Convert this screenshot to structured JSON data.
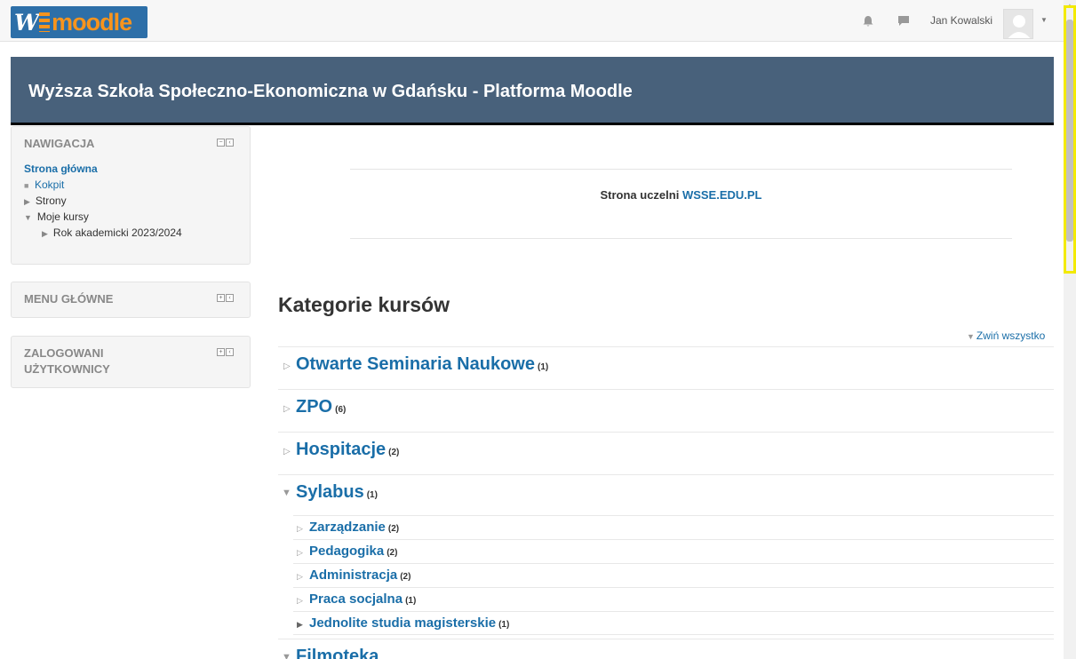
{
  "navbar": {
    "logo_text_w": "W",
    "logo_text_moodle": "moodle",
    "user_name": "Jan Kowalski"
  },
  "banner": {
    "title": "Wyższa Szkoła Społeczno-Ekonomiczna w Gdańsku - Platforma Moodle"
  },
  "sidebar": {
    "navigation": {
      "title": "NAWIGACJA",
      "home": "Strona główna",
      "items": [
        {
          "label": "Kokpit",
          "marker": "■"
        },
        {
          "label": "Strony",
          "marker": "▶"
        },
        {
          "label": "Moje kursy",
          "marker": "▼"
        },
        {
          "label": "Rok akademicki 2023/2024",
          "marker": "▶"
        }
      ]
    },
    "main_menu": {
      "title": "MENU GŁÓWNE"
    },
    "logged_users": {
      "title_line1": "ZALOGOWANI",
      "title_line2": "UŻYTKOWNICY"
    }
  },
  "main": {
    "uni_text": "Strona uczelni ",
    "uni_link": "WSSE.EDU.PL",
    "section_title": "Kategorie kursów",
    "collapse_all": "Zwiń wszystko",
    "categories": [
      {
        "name": "Otwarte Seminaria Naukowe",
        "count": "(1)"
      },
      {
        "name": "ZPO",
        "count": "(6)"
      },
      {
        "name": "Hospitacje",
        "count": "(2)"
      },
      {
        "name": "Sylabus",
        "count": "(1)"
      },
      {
        "name": "Filmoteka",
        "count": ""
      }
    ],
    "subcategories": [
      {
        "name": "Zarządzanie",
        "count": "(2)"
      },
      {
        "name": "Pedagogika",
        "count": "(2)"
      },
      {
        "name": "Administracja",
        "count": "(2)"
      },
      {
        "name": "Praca socjalna",
        "count": "(1)"
      },
      {
        "name": "Jednolite studia magisterskie",
        "count": "(1)"
      }
    ]
  },
  "colors": {
    "banner": "#48617b",
    "link": "#1a6ea8",
    "highlight": "#f3ea00"
  }
}
